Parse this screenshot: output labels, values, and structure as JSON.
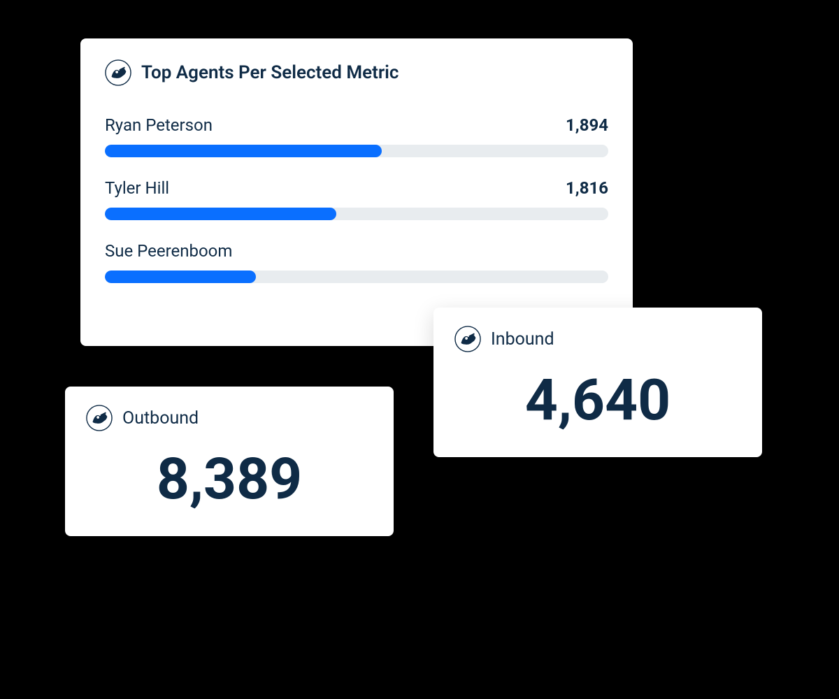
{
  "topCard": {
    "title": "Top Agents Per Selected Metric",
    "agents": [
      {
        "name": "Ryan Peterson",
        "value": "1,894",
        "percent": 55
      },
      {
        "name": "Tyler Hill",
        "value": "1,816",
        "percent": 46
      },
      {
        "name": "Sue Peerenboom",
        "value": "",
        "percent": 30
      }
    ]
  },
  "outbound": {
    "label": "Outbound",
    "value": "8,389"
  },
  "inbound": {
    "label": "Inbound",
    "value": "4,640"
  }
}
